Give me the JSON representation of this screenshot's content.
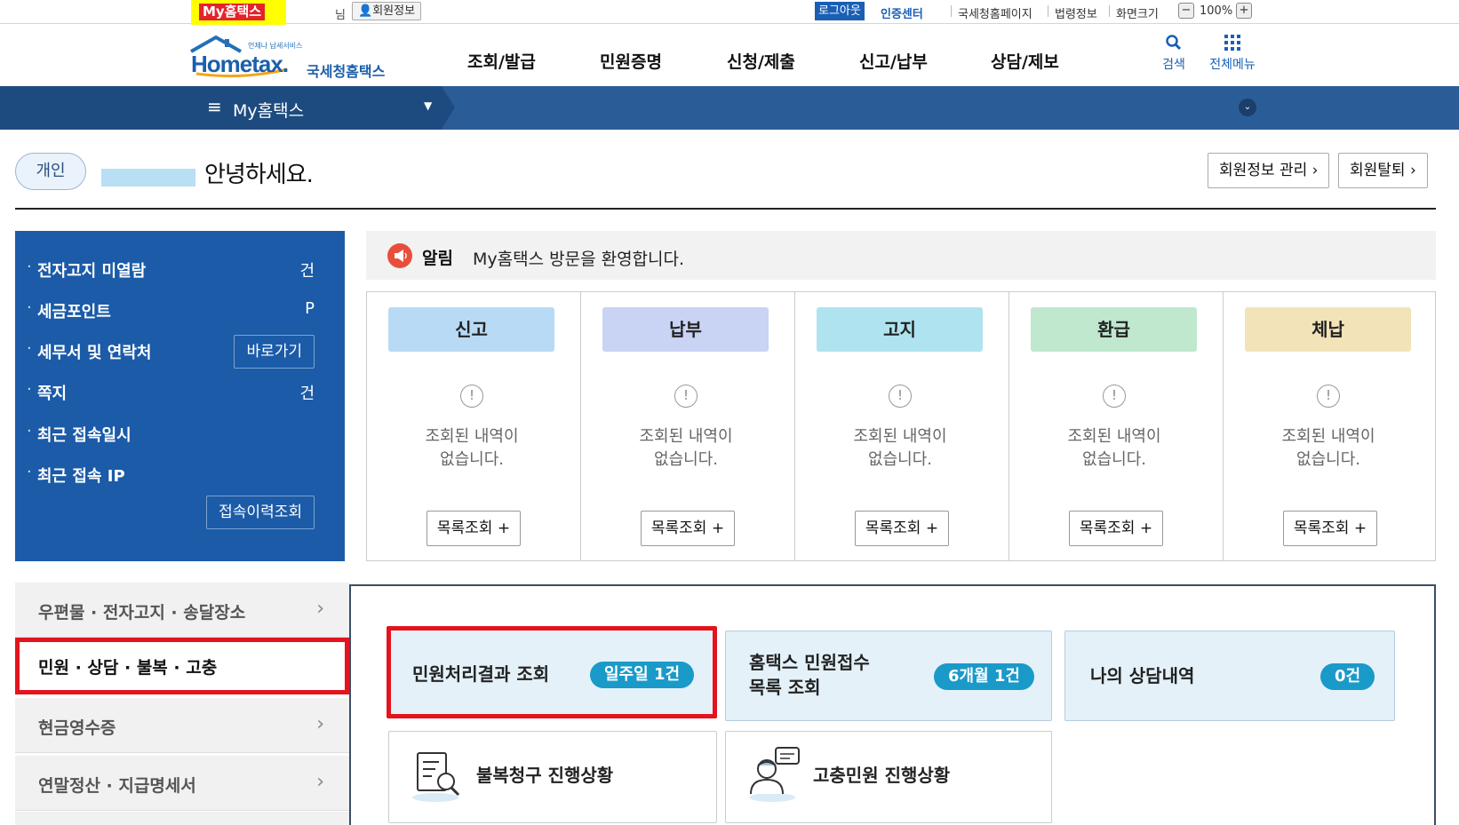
{
  "util": {
    "mytax_tag": "My홈택스",
    "nim": "님",
    "member_info": "회원정보",
    "logout": "로그아웃",
    "cert_center": "인증센터",
    "links": [
      "국세청홈페이지",
      "법령정보",
      "화면크기"
    ],
    "zoom_minus": "−",
    "zoom_value": "100%",
    "zoom_plus": "+"
  },
  "header": {
    "logo_main": "Hometax.",
    "logo_sub": "국세청홈택스",
    "logo_tagline": "언제나 납세서비스",
    "nav": [
      "조회/발급",
      "민원증명",
      "신청/제출",
      "신고/납부",
      "상담/제보"
    ],
    "search_label": "검색",
    "all_menu_label": "전체메뉴"
  },
  "bluebar": {
    "menu_label": "My홈택스"
  },
  "greeting": {
    "badge": "개인",
    "text": "안녕하세요.",
    "member_manage": "회원정보 관리",
    "withdraw": "회원탈퇴"
  },
  "info_panel": {
    "items": [
      {
        "label": "전자고지 미열람",
        "value": "건"
      },
      {
        "label": "세금포인트",
        "value": "P"
      },
      {
        "label": "세무서 및 연락처",
        "button": "바로가기"
      },
      {
        "label": "쪽지",
        "value": "건"
      },
      {
        "label": "최근 접속일시",
        "value": ""
      },
      {
        "label": "최근 접속 IP",
        "value": ""
      }
    ],
    "history_button": "접속이력조회"
  },
  "alert": {
    "label": "알림",
    "message": "My홈택스 방문을 환영합니다."
  },
  "status": {
    "empty_line1": "조회된 내역이",
    "empty_line2": "없습니다.",
    "list_button": "목록조회 +",
    "columns": [
      {
        "title": "신고",
        "color": "#b8daf5"
      },
      {
        "title": "납부",
        "color": "#c9d3f3"
      },
      {
        "title": "고지",
        "color": "#aee3ef"
      },
      {
        "title": "환급",
        "color": "#bfe8cf"
      },
      {
        "title": "체납",
        "color": "#f2e3b8"
      }
    ]
  },
  "side_menu": [
    "우편물 · 전자고지 · 송달장소",
    "민원 · 상담 · 불복 · 고충",
    "현금영수증",
    "연말정산 · 지급명세서"
  ],
  "tiles": {
    "civil_result": {
      "label": "민원처리결과 조회",
      "badge": "일주일 1건"
    },
    "hometax_civil": {
      "label_line1": "홈택스 민원접수",
      "label_line2": "목록 조회",
      "badge": "6개월 1건"
    },
    "my_consult": {
      "label": "나의 상담내역",
      "badge": "0건"
    },
    "appeal": {
      "label": "불복청구 진행상황"
    },
    "grievance": {
      "label": "고충민원 진행상황"
    }
  }
}
